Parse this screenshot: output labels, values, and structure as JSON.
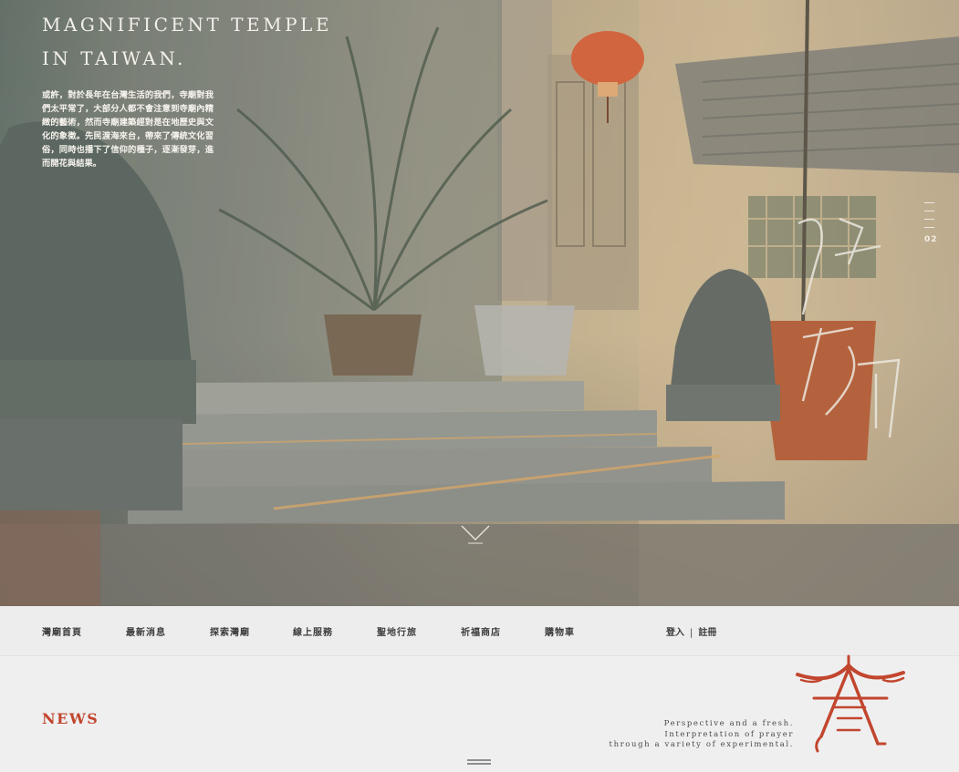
{
  "hero": {
    "title_line1": "MAGNIFICENT TEMPLE",
    "title_line2": "IN TAIWAN.",
    "description": "或許，對於長年在台灣生活的我們，寺廟對我們太平常了，大部分人都不會注意到寺廟內精緻的藝術，然而寺廟建築經對是在地歷史與文化的象徵。先民渡海來台，帶來了傳統文化習俗，同時也播下了信仰的種子，逐漸發芽，進而開花與結果。",
    "slide_number": "02"
  },
  "nav": {
    "items": [
      "灣廟首頁",
      "最新消息",
      "探索灣廟",
      "線上服務",
      "聖地行旅",
      "祈福商店",
      "購物車"
    ],
    "login": "登入",
    "separator": "|",
    "register": "註冊"
  },
  "news": {
    "title": "NEWS",
    "tagline_line1": "Perspective and a fresh.",
    "tagline_line2": "Interpretation of prayer",
    "tagline_line3": "through a variety of experimental."
  },
  "colors": {
    "accent": "#c2462e",
    "nav_bg": "#ededee",
    "page_bg": "#efeff0"
  },
  "icons": {
    "scroll": "chevron-down-icon",
    "logo": "temple-logo-icon"
  }
}
